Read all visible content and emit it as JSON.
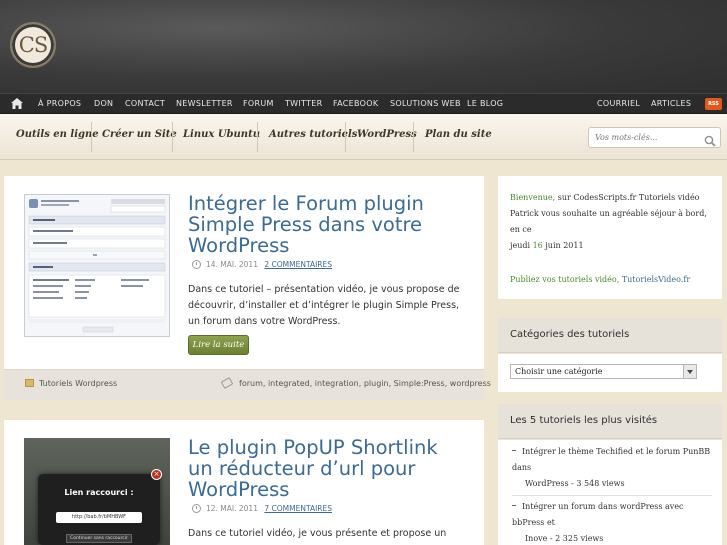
{
  "logo": {
    "text": "CS"
  },
  "topnav": {
    "items": [
      "À PROPOS",
      "DON",
      "CONTACT",
      "NEWSLETTER",
      "FORUM",
      "TWITTER",
      "FACEBOOK",
      "SOLUTIONS WEB",
      "LE BLOG"
    ],
    "right": [
      "COURRIEL",
      "ARTICLES"
    ],
    "rss_label": "RSS"
  },
  "catbar": {
    "items": [
      "Outils en ligne",
      "Créer un Site",
      "Linux Ubuntu",
      "Autres tutoriels",
      "WordPress",
      "Plan du site"
    ],
    "search_placeholder": "Vos mots-clés..."
  },
  "posts": [
    {
      "title": "Intégrer le Forum plugin Simple Press dans votre WordPress",
      "date": "14. MAI. 2011",
      "comments": "2 COMMENTAIRES",
      "excerpt": "Dans ce tutoriel – présentation vidéo, je vous propose de découvrir, d’installer et d’intégrer le plugin Simple Press, un forum dans votre WordPress.",
      "read_more": "Lire la suite",
      "category": "Tutoriels Wordpress",
      "tags": "forum, integrated, integration, plugin, Simple:Press, wordpress"
    },
    {
      "title": "Le plugin PopUP Shortlink un réducteur d’url pour WordPress",
      "date": "12. MAI. 2011",
      "comments": "7 COMMENTAIRES",
      "excerpt": "Dans ce tutoriel vidéo, je vous présente et propose un",
      "thumb_title": "Lien raccourci :",
      "thumb_url": "http://bab.fr/bMHBWF",
      "thumb_btn": "Continuer sans raccourcir"
    }
  ],
  "sidebar": {
    "welcome": {
      "line1_green": "Bienvenue,",
      "line1": " sur CodesScripts.fr Tutoriels vidéo",
      "line2": "Patrick vous souhaite un agréable séjour à bord, en ce",
      "line3_a": "jeudi ",
      "line3_green": "16",
      "line3_b": " juin 2011",
      "promo_green": "Publiez vos tutoriels vidéo,",
      "promo_link": "TutorielsVideo.fr"
    },
    "categories": {
      "title": "Catégories des tutoriels",
      "select": "Choisir une catégorie"
    },
    "popular": {
      "title": "Les 5 tutoriels les plus visités",
      "items": [
        {
          "l1": "Intégrer le thème Techified et le forum PunBB dans",
          "l2": "WordPress - 3 548 views"
        },
        {
          "l1": "Intégrer un forum dans wordPress avec bbPress et",
          "l2": "Inove - 2 325 views"
        }
      ]
    }
  }
}
